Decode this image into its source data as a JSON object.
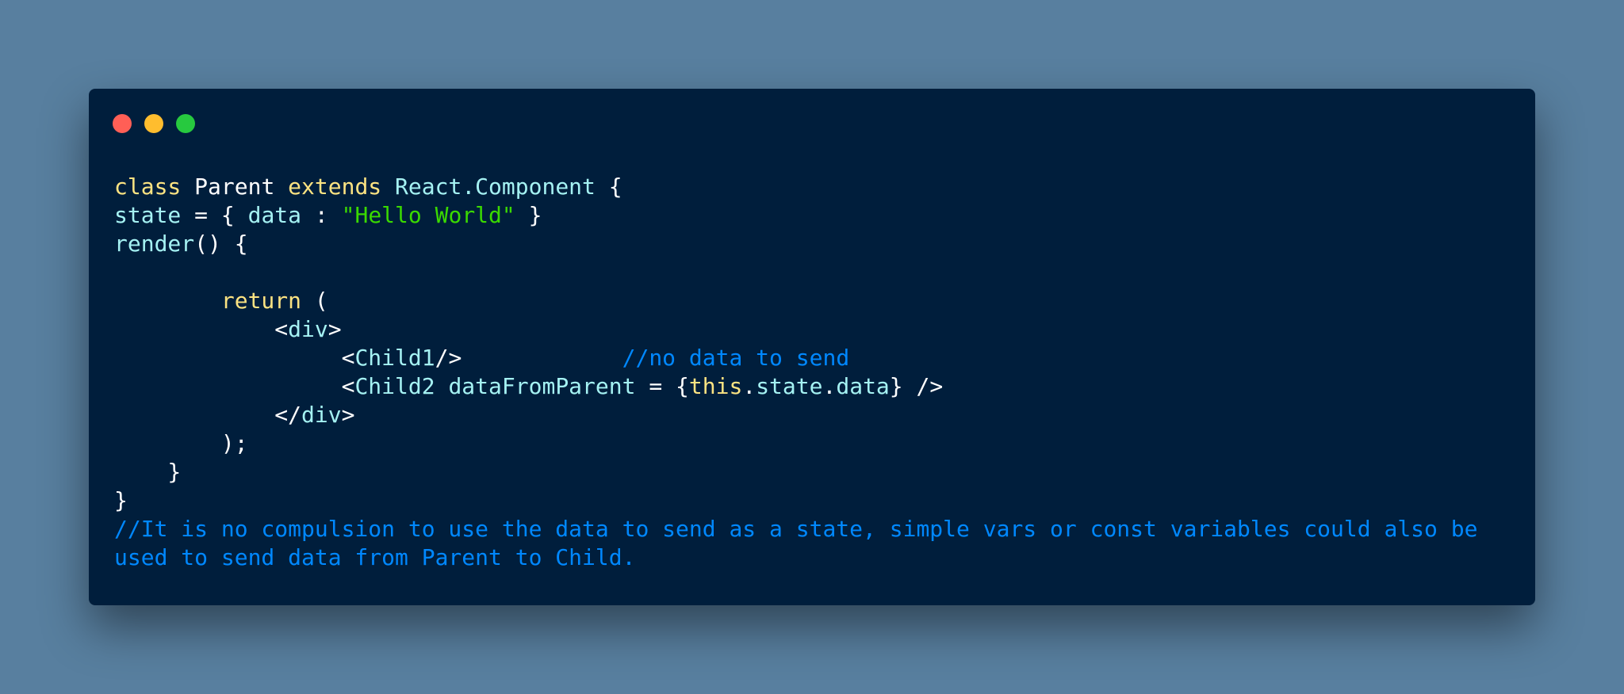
{
  "window": {
    "controls": [
      "close",
      "minimize",
      "maximize"
    ],
    "colors": {
      "background": "#001e3c",
      "page_background": "#587f9f",
      "close": "#ff5f56",
      "minimize": "#ffbd2e",
      "maximize": "#27c93f"
    }
  },
  "code": {
    "syntax_colors": {
      "keyword": "#fce382",
      "identifier": "#a5f2f3",
      "string": "#3ad900",
      "comment": "#0088ff",
      "plain": "#ffffff"
    },
    "lines": [
      {
        "tokens": [
          {
            "t": "class",
            "c": "kw"
          },
          {
            "t": " Parent ",
            "c": "plain"
          },
          {
            "t": "extends",
            "c": "kw"
          },
          {
            "t": " ",
            "c": "plain"
          },
          {
            "t": "React.Component",
            "c": "name"
          },
          {
            "t": " {",
            "c": "plain"
          }
        ]
      },
      {
        "tokens": [
          {
            "t": "state",
            "c": "name"
          },
          {
            "t": " = { ",
            "c": "plain"
          },
          {
            "t": "data",
            "c": "name"
          },
          {
            "t": " : ",
            "c": "plain"
          },
          {
            "t": "\"Hello World\"",
            "c": "str"
          },
          {
            "t": " }",
            "c": "plain"
          }
        ]
      },
      {
        "tokens": [
          {
            "t": "render",
            "c": "name"
          },
          {
            "t": "() {",
            "c": "plain"
          }
        ]
      },
      {
        "tokens": []
      },
      {
        "tokens": [
          {
            "t": "        ",
            "c": "plain"
          },
          {
            "t": "return",
            "c": "kw"
          },
          {
            "t": " (",
            "c": "plain"
          }
        ]
      },
      {
        "tokens": [
          {
            "t": "            <",
            "c": "plain"
          },
          {
            "t": "div",
            "c": "name"
          },
          {
            "t": ">",
            "c": "plain"
          }
        ]
      },
      {
        "tokens": [
          {
            "t": "                 <",
            "c": "plain"
          },
          {
            "t": "Child1",
            "c": "name"
          },
          {
            "t": "/>            ",
            "c": "plain"
          },
          {
            "t": "//no data to send",
            "c": "cmt"
          }
        ]
      },
      {
        "tokens": [
          {
            "t": "                 <",
            "c": "plain"
          },
          {
            "t": "Child2",
            "c": "name"
          },
          {
            "t": " ",
            "c": "plain"
          },
          {
            "t": "dataFromParent",
            "c": "name"
          },
          {
            "t": " = {",
            "c": "plain"
          },
          {
            "t": "this",
            "c": "kw"
          },
          {
            "t": ".",
            "c": "plain"
          },
          {
            "t": "state",
            "c": "name"
          },
          {
            "t": ".",
            "c": "plain"
          },
          {
            "t": "data",
            "c": "name"
          },
          {
            "t": "} />",
            "c": "plain"
          }
        ]
      },
      {
        "tokens": [
          {
            "t": "            </",
            "c": "plain"
          },
          {
            "t": "div",
            "c": "name"
          },
          {
            "t": ">",
            "c": "plain"
          }
        ]
      },
      {
        "tokens": [
          {
            "t": "        );",
            "c": "plain"
          }
        ]
      },
      {
        "tokens": [
          {
            "t": "    }",
            "c": "plain"
          }
        ]
      },
      {
        "tokens": [
          {
            "t": "}",
            "c": "plain"
          }
        ]
      },
      {
        "wrap": true,
        "tokens": [
          {
            "t": "//It is no compulsion to use the data to send as a state, simple vars or const variables could also be used to send data from Parent to Child.",
            "c": "cmt"
          }
        ]
      }
    ]
  }
}
